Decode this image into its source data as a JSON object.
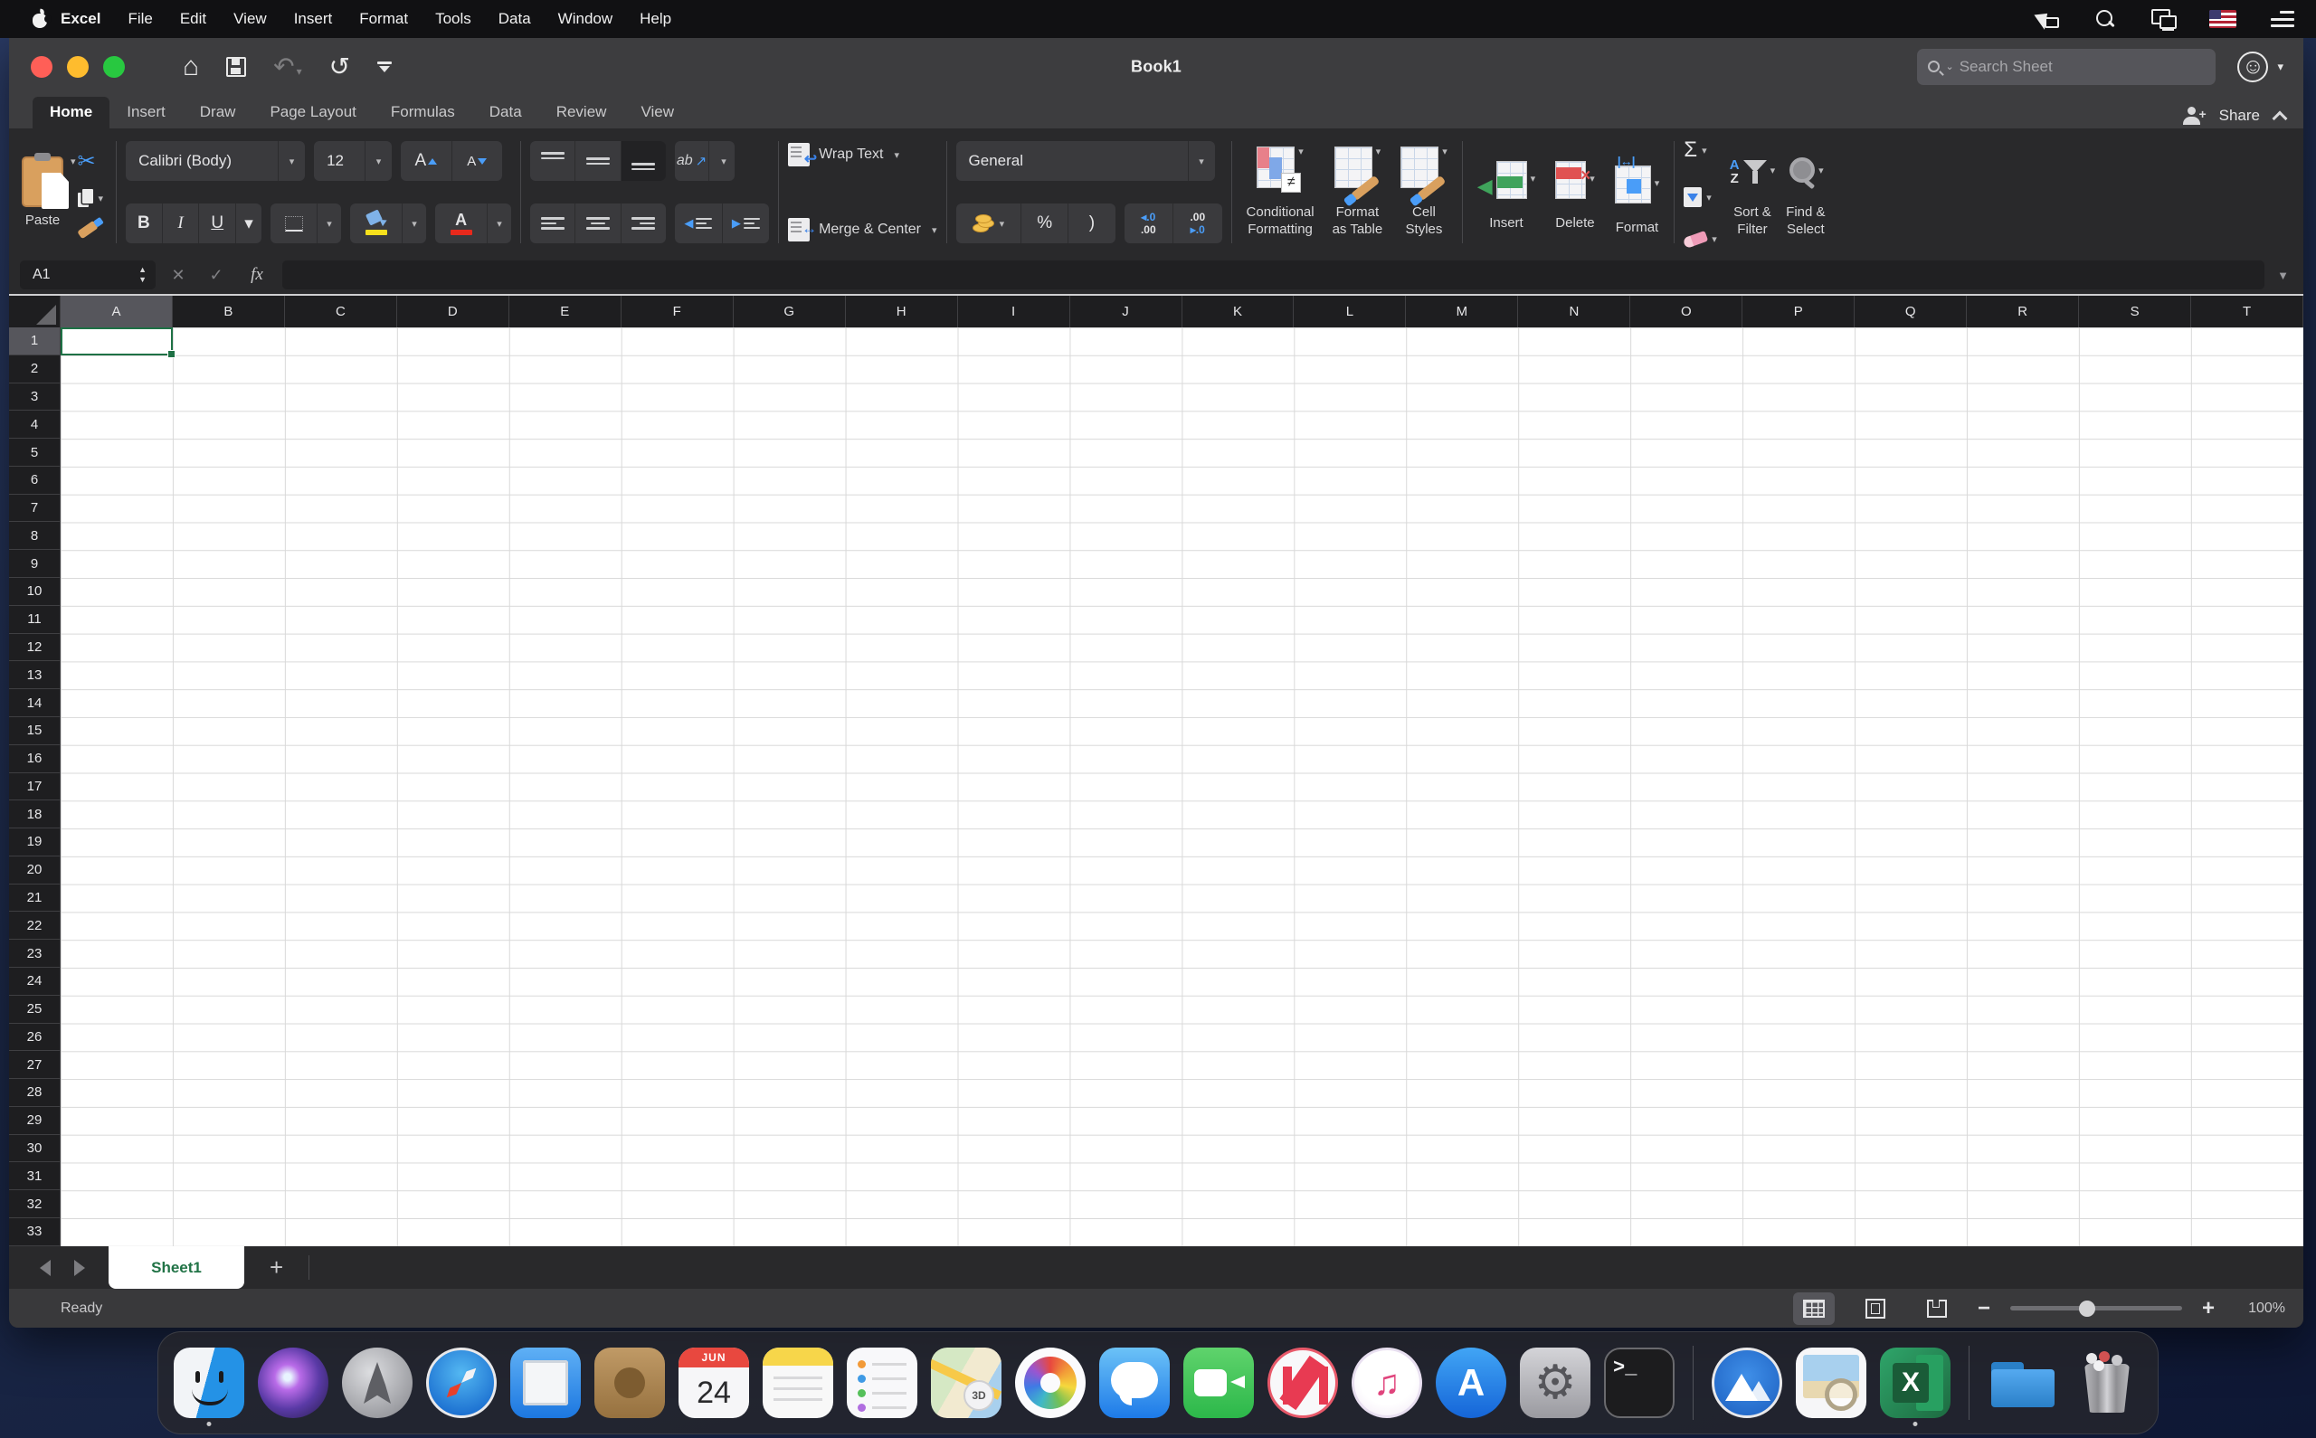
{
  "colors": {
    "excel_green": "#217346",
    "selection_green": "#1E7145",
    "traffic_red": "#FF5F57",
    "traffic_yellow": "#FEBC2E",
    "traffic_green": "#28C840",
    "accent_blue": "#4A9DF8",
    "ribbon_bg": "#29292B",
    "titlebar_bg": "#3D3D3F"
  },
  "menubar": {
    "app_name": "Excel",
    "items": [
      "File",
      "Edit",
      "View",
      "Insert",
      "Format",
      "Tools",
      "Data",
      "Window",
      "Help"
    ],
    "status_icons": [
      "screen-sharing-pointer",
      "spotlight-search",
      "airplay-displays",
      "input-language-us-flag",
      "notification-center"
    ]
  },
  "titlebar": {
    "title": "Book1",
    "search_placeholder": "Search Sheet"
  },
  "ribbon": {
    "tabs": [
      {
        "label": "Home",
        "active": true
      },
      {
        "label": "Insert",
        "active": false
      },
      {
        "label": "Draw",
        "active": false
      },
      {
        "label": "Page Layout",
        "active": false
      },
      {
        "label": "Formulas",
        "active": false
      },
      {
        "label": "Data",
        "active": false
      },
      {
        "label": "Review",
        "active": false
      },
      {
        "label": "View",
        "active": false
      }
    ],
    "share_label": "Share",
    "home": {
      "paste_label": "Paste",
      "font_name": "Calibri (Body)",
      "font_size": "12",
      "wrap_text_label": "Wrap Text",
      "merge_center_label": "Merge & Center",
      "number_format": "General",
      "conditional_formatting_label": "Conditional\nFormatting",
      "format_as_table_label": "Format\nas Table",
      "cell_styles_label": "Cell\nStyles",
      "insert_label": "Insert",
      "delete_label": "Delete",
      "format_label": "Format",
      "sort_filter_label": "Sort &\nFilter",
      "find_select_label": "Find &\nSelect"
    },
    "glyphs": {
      "bold": "B",
      "italic": "I",
      "underline": "U",
      "increase_font": "A",
      "decrease_font": "A",
      "orientation_ab": "ab",
      "orientation_arrow": "↗",
      "wrap_arrow": "↩",
      "merge_arrow": "↔",
      "percent": "%",
      "comma_style": ")",
      "inc_dec_top_left": "◂.0",
      "inc_dec_bot_left": ".00",
      "inc_dec_top_right": ".00",
      "inc_dec_bot_right": "▸.0",
      "autosum": "Σ",
      "not_equal": "≠",
      "delete_x": "×",
      "insert_arrow": "◀",
      "format_width_arrow": "↔",
      "font_color_a": "A",
      "sort_a": "A",
      "sort_z": "Z",
      "dropdown": "▾",
      "cut": "✂"
    }
  },
  "quick_access": {
    "icons": [
      "home",
      "save",
      "undo",
      "redo",
      "customize-toolbar"
    ],
    "home_glyph": "⌂",
    "undo_glyph": "↶",
    "redo_glyph": "↺",
    "smiley_glyph": "☺"
  },
  "formula_bar": {
    "name_box": "A1",
    "cancel_glyph": "✕",
    "enter_glyph": "✓",
    "fx_label": "fx",
    "formula_value": "",
    "expand_glyph": "▼",
    "spinner_up": "▲",
    "spinner_down": "▼"
  },
  "grid": {
    "columns": [
      "A",
      "B",
      "C",
      "D",
      "E",
      "F",
      "G",
      "H",
      "I",
      "J",
      "K",
      "L",
      "M",
      "N",
      "O",
      "P",
      "Q",
      "R",
      "S",
      "T"
    ],
    "rows": [
      "1",
      "2",
      "3",
      "4",
      "5",
      "6",
      "7",
      "8",
      "9",
      "10",
      "11",
      "12",
      "13",
      "14",
      "15",
      "16",
      "17",
      "18",
      "19",
      "20",
      "21",
      "22",
      "23",
      "24",
      "25",
      "26",
      "27",
      "28",
      "29",
      "30",
      "31",
      "32",
      "33"
    ],
    "selected_cell": "A1",
    "selected_column": "A",
    "selected_row": "1"
  },
  "sheet_bar": {
    "nav": [
      "scroll-sheets-left",
      "scroll-sheets-right"
    ],
    "tabs": [
      {
        "label": "Sheet1",
        "active": true
      }
    ],
    "add_label": "+"
  },
  "status_bar": {
    "status": "Ready",
    "views": [
      "normal-view",
      "page-layout-view",
      "page-break-view"
    ],
    "active_view": "normal-view",
    "zoom_minus": "−",
    "zoom_plus": "+",
    "zoom_level": "100%",
    "zoom_slider_pos": "45%"
  },
  "dock": {
    "items": [
      {
        "icon": "finder",
        "running": true
      },
      {
        "icon": "siri",
        "running": false
      },
      {
        "icon": "launchpad",
        "running": false
      },
      {
        "icon": "safari",
        "running": false
      },
      {
        "icon": "mail",
        "running": false
      },
      {
        "icon": "contacts",
        "running": false
      },
      {
        "icon": "calendar",
        "running": false,
        "month": "JUN",
        "day": "24"
      },
      {
        "icon": "notes",
        "running": false
      },
      {
        "icon": "reminders",
        "running": false
      },
      {
        "icon": "maps",
        "running": false
      },
      {
        "icon": "photos",
        "running": false
      },
      {
        "icon": "messages",
        "running": false
      },
      {
        "icon": "facetime",
        "running": false
      },
      {
        "icon": "news",
        "running": false
      },
      {
        "icon": "itunes",
        "running": false,
        "glyph": "♫"
      },
      {
        "icon": "app-store",
        "running": false,
        "glyph": "A"
      },
      {
        "icon": "system-preferences",
        "running": false,
        "glyph": "⚙"
      },
      {
        "icon": "terminal",
        "running": false,
        "glyph": ">_"
      },
      {
        "divider": true
      },
      {
        "icon": "app-blue-mountain",
        "running": false
      },
      {
        "icon": "preview",
        "running": false
      },
      {
        "icon": "excel",
        "running": true,
        "glyph": "X"
      },
      {
        "divider": true
      },
      {
        "icon": "downloads-folder",
        "running": false
      },
      {
        "icon": "trash",
        "running": false
      }
    ]
  }
}
